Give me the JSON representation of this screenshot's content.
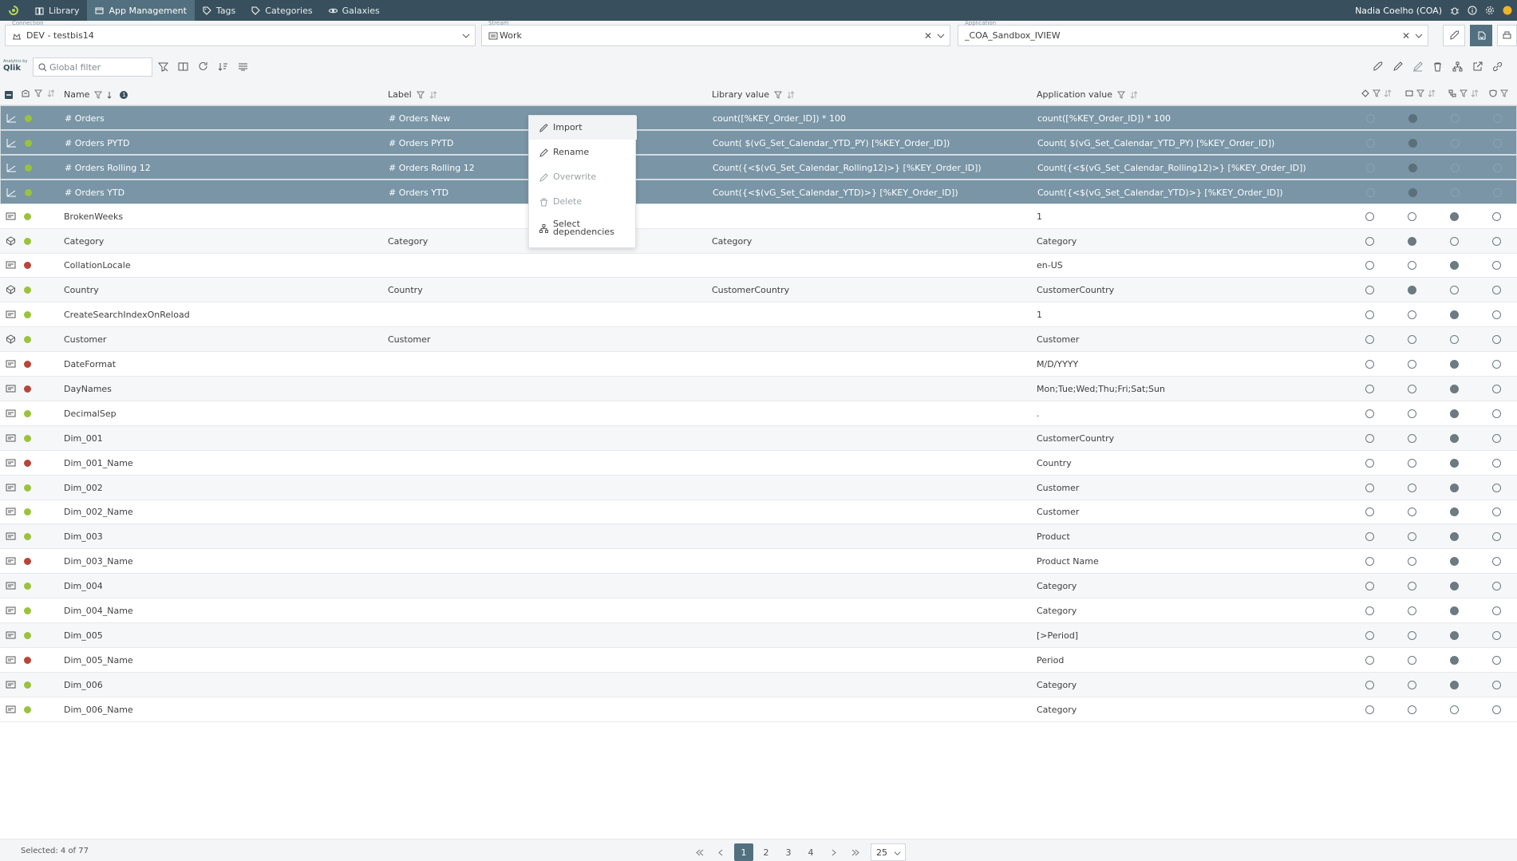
{
  "nav": {
    "items": [
      {
        "label": "Library",
        "icon": "book-icon"
      },
      {
        "label": "App Management",
        "icon": "app-icon"
      },
      {
        "label": "Tags",
        "icon": "tag-icon"
      },
      {
        "label": "Categories",
        "icon": "category-icon"
      },
      {
        "label": "Galaxies",
        "icon": "galaxy-icon"
      }
    ],
    "active_index": 1,
    "user": "Nadia Coelho (COA)"
  },
  "selectors": {
    "connection": {
      "caption": "Connection",
      "value": "DEV - testbis14"
    },
    "stream": {
      "caption": "Stream",
      "value": "Work"
    },
    "application": {
      "caption": "Application",
      "value": "_COA_Sandbox_IVIEW"
    }
  },
  "toolbar": {
    "logo_top": "Analytics by",
    "logo_text": "Qlik",
    "filter_placeholder": "Global filter"
  },
  "columns": {
    "name": "Name",
    "label": "Label",
    "library_value": "Library value",
    "application_value": "Application value",
    "sort_badge": "1"
  },
  "rows": [
    {
      "type": "measure",
      "status": "green",
      "name": "# Orders",
      "label": "# Orders New",
      "library": "count([%KEY_Order_ID]) * 100",
      "app": "count([%KEY_Order_ID]) * 100",
      "flags": [
        0,
        1,
        0,
        0
      ],
      "selected": true
    },
    {
      "type": "measure",
      "status": "green",
      "name": "# Orders PYTD",
      "label": "# Orders PYTD",
      "library": "Count( $(vG_Set_Calendar_YTD_PY) [%KEY_Order_ID])",
      "app": "Count( $(vG_Set_Calendar_YTD_PY) [%KEY_Order_ID])",
      "flags": [
        0,
        1,
        0,
        0
      ],
      "selected": true
    },
    {
      "type": "measure",
      "status": "green",
      "name": "# Orders Rolling 12",
      "label": "# Orders Rolling 12",
      "library": "Count({<$(vG_Set_Calendar_Rolling12)>} [%KEY_Order_ID])",
      "app": "Count({<$(vG_Set_Calendar_Rolling12)>} [%KEY_Order_ID])",
      "flags": [
        0,
        1,
        0,
        0
      ],
      "selected": true
    },
    {
      "type": "measure",
      "status": "green",
      "name": "# Orders YTD",
      "label": "# Orders YTD",
      "library": "Count({<$(vG_Set_Calendar_YTD)>} [%KEY_Order_ID])",
      "app": "Count({<$(vG_Set_Calendar_YTD)>} [%KEY_Order_ID])",
      "flags": [
        0,
        1,
        0,
        0
      ],
      "selected": true
    },
    {
      "type": "variable",
      "status": "green",
      "name": "BrokenWeeks",
      "label": "",
      "library": "",
      "app": "1",
      "flags": [
        0,
        0,
        1,
        0
      ],
      "selected": false
    },
    {
      "type": "dimension",
      "status": "green",
      "name": "Category",
      "label": "Category",
      "library": "Category",
      "app": "Category",
      "flags": [
        0,
        1,
        0,
        0
      ],
      "selected": false
    },
    {
      "type": "variable",
      "status": "red",
      "name": "CollationLocale",
      "label": "",
      "library": "",
      "app": "en-US",
      "flags": [
        0,
        0,
        1,
        0
      ],
      "selected": false
    },
    {
      "type": "dimension",
      "status": "green",
      "name": "Country",
      "label": "Country",
      "library": "CustomerCountry",
      "app": "CustomerCountry",
      "flags": [
        0,
        1,
        0,
        0
      ],
      "selected": false
    },
    {
      "type": "variable",
      "status": "green",
      "name": "CreateSearchIndexOnReload",
      "label": "",
      "library": "",
      "app": "1",
      "flags": [
        0,
        0,
        1,
        0
      ],
      "selected": false
    },
    {
      "type": "dimension",
      "status": "green",
      "name": "Customer",
      "label": "Customer",
      "library": "",
      "app": "Customer",
      "flags": [
        0,
        0,
        0,
        0
      ],
      "selected": false
    },
    {
      "type": "variable",
      "status": "red",
      "name": "DateFormat",
      "label": "",
      "library": "",
      "app": "M/D/YYYY",
      "flags": [
        0,
        0,
        1,
        0
      ],
      "selected": false
    },
    {
      "type": "variable",
      "status": "red",
      "name": "DayNames",
      "label": "",
      "library": "",
      "app": "Mon;Tue;Wed;Thu;Fri;Sat;Sun",
      "flags": [
        0,
        0,
        1,
        0
      ],
      "selected": false
    },
    {
      "type": "variable",
      "status": "green",
      "name": "DecimalSep",
      "label": "",
      "library": "",
      "app": ".",
      "flags": [
        0,
        0,
        1,
        0
      ],
      "selected": false
    },
    {
      "type": "variable",
      "status": "green",
      "name": "Dim_001",
      "label": "",
      "library": "",
      "app": "CustomerCountry",
      "flags": [
        0,
        0,
        1,
        0
      ],
      "selected": false
    },
    {
      "type": "variable",
      "status": "red",
      "name": "Dim_001_Name",
      "label": "",
      "library": "",
      "app": "Country",
      "flags": [
        0,
        0,
        1,
        0
      ],
      "selected": false
    },
    {
      "type": "variable",
      "status": "green",
      "name": "Dim_002",
      "label": "",
      "library": "",
      "app": "Customer",
      "flags": [
        0,
        0,
        1,
        0
      ],
      "selected": false
    },
    {
      "type": "variable",
      "status": "green",
      "name": "Dim_002_Name",
      "label": "",
      "library": "",
      "app": "Customer",
      "flags": [
        0,
        0,
        1,
        0
      ],
      "selected": false
    },
    {
      "type": "variable",
      "status": "green",
      "name": "Dim_003",
      "label": "",
      "library": "",
      "app": "Product",
      "flags": [
        0,
        0,
        1,
        0
      ],
      "selected": false
    },
    {
      "type": "variable",
      "status": "red",
      "name": "Dim_003_Name",
      "label": "",
      "library": "",
      "app": "Product Name",
      "flags": [
        0,
        0,
        1,
        0
      ],
      "selected": false
    },
    {
      "type": "variable",
      "status": "green",
      "name": "Dim_004",
      "label": "",
      "library": "",
      "app": "Category",
      "flags": [
        0,
        0,
        1,
        0
      ],
      "selected": false
    },
    {
      "type": "variable",
      "status": "green",
      "name": "Dim_004_Name",
      "label": "",
      "library": "",
      "app": "Category",
      "flags": [
        0,
        0,
        1,
        0
      ],
      "selected": false
    },
    {
      "type": "variable",
      "status": "green",
      "name": "Dim_005",
      "label": "",
      "library": "",
      "app": "[>Period]",
      "flags": [
        0,
        0,
        1,
        0
      ],
      "selected": false
    },
    {
      "type": "variable",
      "status": "red",
      "name": "Dim_005_Name",
      "label": "",
      "library": "",
      "app": "Period",
      "flags": [
        0,
        0,
        1,
        0
      ],
      "selected": false
    },
    {
      "type": "variable",
      "status": "green",
      "name": "Dim_006",
      "label": "",
      "library": "",
      "app": "Category",
      "flags": [
        0,
        0,
        1,
        0
      ],
      "selected": false
    },
    {
      "type": "variable",
      "status": "green",
      "name": "Dim_006_Name",
      "label": "",
      "library": "",
      "app": "Category",
      "flags": [
        0,
        0,
        0,
        0
      ],
      "selected": false
    }
  ],
  "context_menu": [
    {
      "label": "Import",
      "icon": "rocket-icon",
      "disabled": false,
      "hover": true
    },
    {
      "label": "Rename",
      "icon": "pencil-icon",
      "disabled": false,
      "hover": false
    },
    {
      "label": "Overwrite",
      "icon": "overwrite-icon",
      "disabled": true,
      "hover": false
    },
    {
      "label": "Delete",
      "icon": "trash-icon",
      "disabled": true,
      "hover": false
    },
    {
      "label": "Select dependencies",
      "icon": "dependencies-icon",
      "disabled": false,
      "hover": false
    }
  ],
  "footer": {
    "selected_text": "Selected: 4 of 77",
    "pages": [
      "1",
      "2",
      "3",
      "4"
    ],
    "current_page": "1",
    "page_size": "25"
  },
  "colors": {
    "nav_bg": "#38505d",
    "selected_row": "#7995a6",
    "status_green": "#9ac33b",
    "status_red": "#b8453a"
  }
}
